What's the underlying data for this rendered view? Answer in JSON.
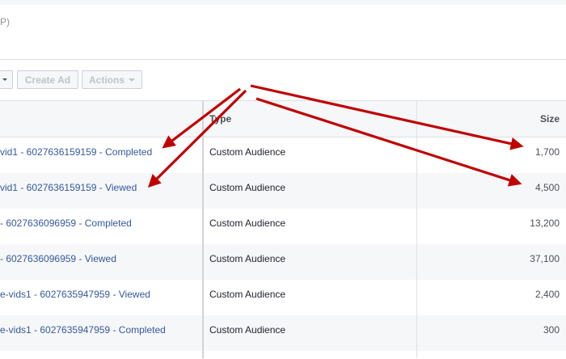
{
  "header": {
    "fragment": "P)"
  },
  "toolbar": {
    "create_ad_label": "Create Ad",
    "actions_label": "Actions"
  },
  "table": {
    "columns": {
      "type": "Type",
      "size": "Size"
    },
    "rows": [
      {
        "name": "vid1 - 6027636159159 - Completed",
        "type": "Custom Audience",
        "size": "1,700"
      },
      {
        "name": "vid1 - 6027636159159 - Viewed",
        "type": "Custom Audience",
        "size": "4,500"
      },
      {
        "name": "- 6027636096959 - Completed",
        "type": "Custom Audience",
        "size": "13,200"
      },
      {
        "name": "- 6027636096959 - Viewed",
        "type": "Custom Audience",
        "size": "37,100"
      },
      {
        "name": "e-vids1 - 6027635947959 - Viewed",
        "type": "Custom Audience",
        "size": "2,400"
      },
      {
        "name": "e-vids1 - 6027635947959 - Completed",
        "type": "Custom Audience",
        "size": "300"
      }
    ]
  },
  "colors": {
    "link": "#365899",
    "annotation_arrow": "#c00000",
    "row_alt": "#f6f7f9",
    "border": "#dddfe2"
  }
}
